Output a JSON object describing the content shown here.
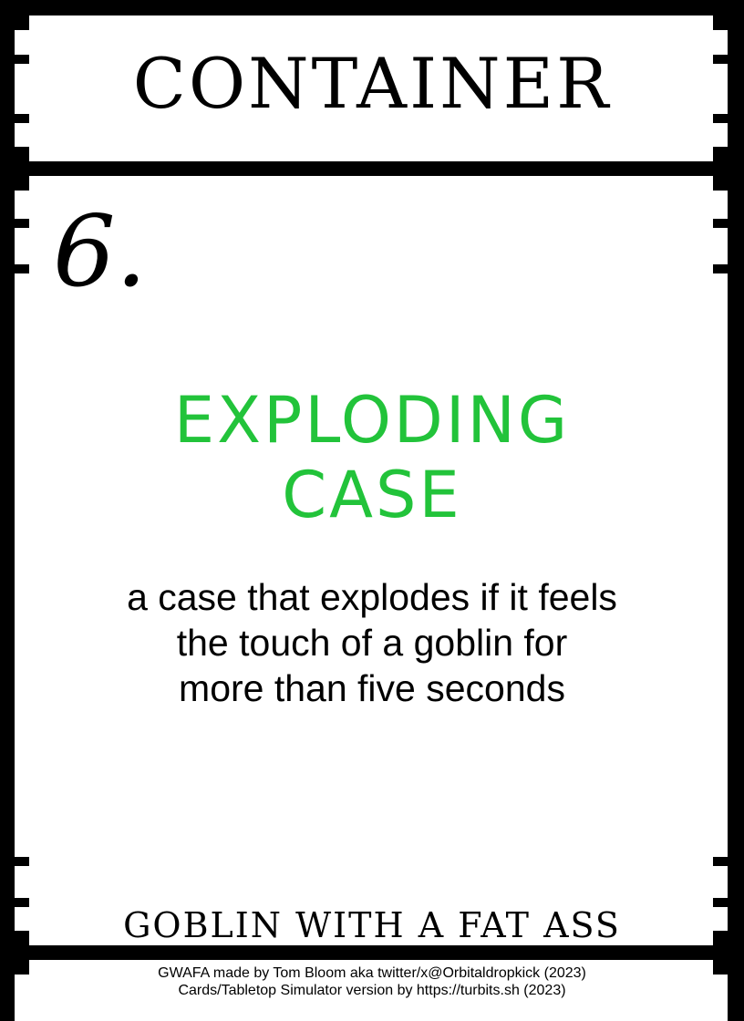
{
  "card": {
    "category": "CONTAINER",
    "number": "6.",
    "name_lines": [
      "EXPLODING",
      "CASE"
    ],
    "description_lines": [
      "a case that explodes if it feels",
      "the touch of a goblin for",
      "more than five seconds"
    ],
    "game_title": "GOBLIN WITH A FAT ASS",
    "credits": [
      "GWAFA made by Tom Bloom aka twitter/x@Orbitaldropkick (2023)",
      "Cards/Tabletop Simulator version by https://turbits.sh (2023)"
    ]
  },
  "colors": {
    "background": "#000000",
    "panel": "#ffffff",
    "accent_green": "#22c33a"
  }
}
